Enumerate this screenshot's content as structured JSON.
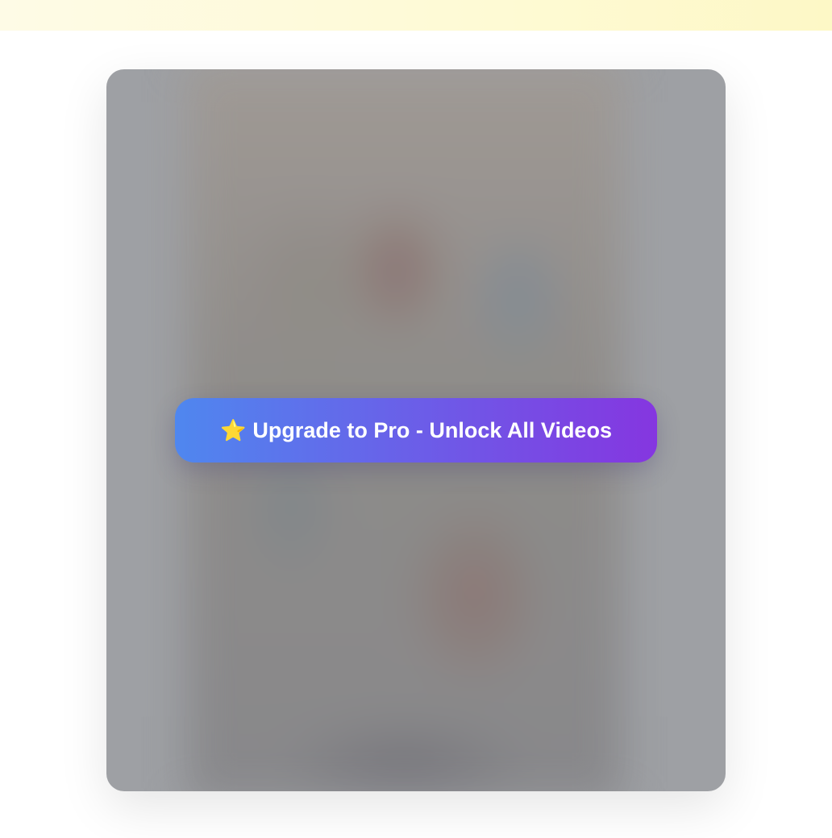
{
  "video_card": {
    "upgrade_button": {
      "icon": "star-icon",
      "icon_glyph": "⭐",
      "label": "Upgrade to Pro - Unlock All Videos"
    }
  },
  "colors": {
    "button_gradient_start": "#4f87ef",
    "button_gradient_end": "#8536e0",
    "overlay_gray": "#9ea0a4"
  }
}
